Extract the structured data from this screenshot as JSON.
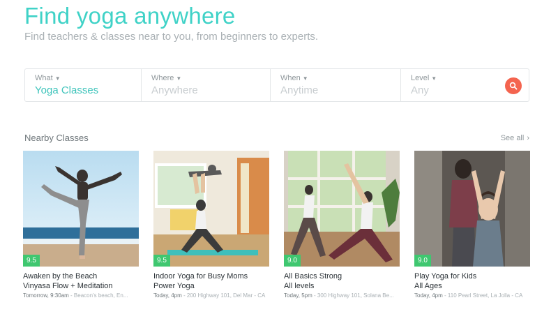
{
  "hero": {
    "title": "Find yoga anywhere",
    "subtitle": "Find teachers & classes near to you, from beginners to experts."
  },
  "search": {
    "fields": [
      {
        "label": "What",
        "value": "Yoga Classes"
      },
      {
        "label": "Where",
        "value": "Anywhere"
      },
      {
        "label": "When",
        "value": "Anytime"
      },
      {
        "label": "Level",
        "value": "Any"
      }
    ],
    "button_icon": "search-icon"
  },
  "nearby": {
    "title": "Nearby Classes",
    "see_all": "See all"
  },
  "classes": [
    {
      "rating": "9.5",
      "title": "Awaken by the Beach",
      "style": "Vinyasa Flow + Meditation",
      "time": "Tomorrow, 9:30am",
      "location": "- Beacon's beach, En..."
    },
    {
      "rating": "9.5",
      "title": "Indoor Yoga for Busy Moms",
      "style": "Power Yoga",
      "time": "Today, 4pm",
      "location": "- 200 Highway 101, Del Mar - CA"
    },
    {
      "rating": "9.0",
      "title": "All Basics Strong",
      "style": "All levels",
      "time": "Today, 5pm",
      "location": "- 300 Highway 101, Solana Be..."
    },
    {
      "rating": "9.0",
      "title": "Play Yoga for Kids",
      "style": "All Ages",
      "time": "Today, 4pm",
      "location": "- 110 Pearl Street, La Jolla - CA"
    }
  ],
  "colors": {
    "accent": "#3fd2c7",
    "search_button": "#f4644f",
    "rating_badge": "#3fc770"
  }
}
